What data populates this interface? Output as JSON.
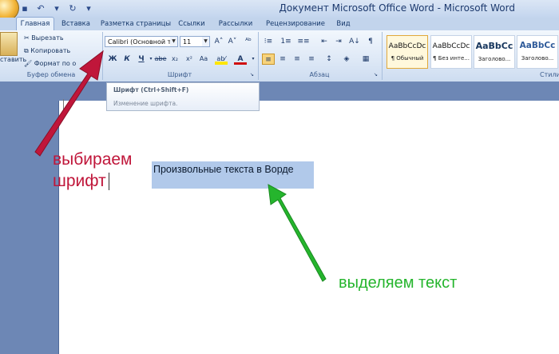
{
  "window": {
    "title": "Документ Microsoft Office Word - Microsoft Word",
    "qat": [
      {
        "icon": "save-icon",
        "glyph": "▪"
      },
      {
        "icon": "undo-icon",
        "glyph": "↶"
      },
      {
        "icon": "dropdown-icon",
        "glyph": "▾"
      },
      {
        "icon": "redo-icon",
        "glyph": "↻"
      },
      {
        "icon": "customize-icon",
        "glyph": "▾"
      }
    ]
  },
  "tabs": [
    "Главная",
    "Вставка",
    "Разметка страницы",
    "Ссылки",
    "Рассылки",
    "Рецензирование",
    "Вид"
  ],
  "clipboard": {
    "paste_label": "ставить",
    "cut_label": "Вырезать",
    "copy_label": "Копировать",
    "format_label": "Формат по о",
    "group_label": "Буфер обмена"
  },
  "font": {
    "font_name": "Calibri (Основной те",
    "font_size": "11",
    "group_label": "Шрифт",
    "grow_glyph": "A˄",
    "shrink_glyph": "A˅",
    "clear_glyph": "ᴬᵇ",
    "bold": "Ж",
    "italic": "К",
    "underline": "Ч",
    "strike": "abe",
    "subscript": "x₂",
    "superscript": "x²",
    "case": "Aa",
    "highlight": "ab⁄",
    "color": "A"
  },
  "paragraph": {
    "group_label": "Абзац",
    "row1": [
      "⁝≡",
      "1≡",
      "≡≡",
      "⇤",
      "⇥",
      "A↓",
      "¶"
    ],
    "row2": [
      "≡",
      "≡",
      "≡",
      "≡",
      "↕",
      "◈",
      "▦"
    ]
  },
  "styles": {
    "group_label": "Стили",
    "items": [
      {
        "sample": "AaBbCcDc",
        "name": "¶ Обычный"
      },
      {
        "sample": "AaBbCcDc",
        "name": "¶ Без инте..."
      },
      {
        "sample": "AaBbCc",
        "name": "Заголово..."
      },
      {
        "sample": "AaBbCc",
        "name": "Заголово..."
      }
    ]
  },
  "tooltip": {
    "title": "Шрифт (Ctrl+Shift+F)",
    "description": "Изменение шрифта."
  },
  "document": {
    "selected_text": "Произвольные текста в Ворде"
  },
  "annotations": {
    "choose_font_line1": "выбираем",
    "choose_font_line2": "шрифт",
    "select_text": "выделяем текст",
    "red_color": "#c0163a",
    "green_color": "#25b52d"
  }
}
